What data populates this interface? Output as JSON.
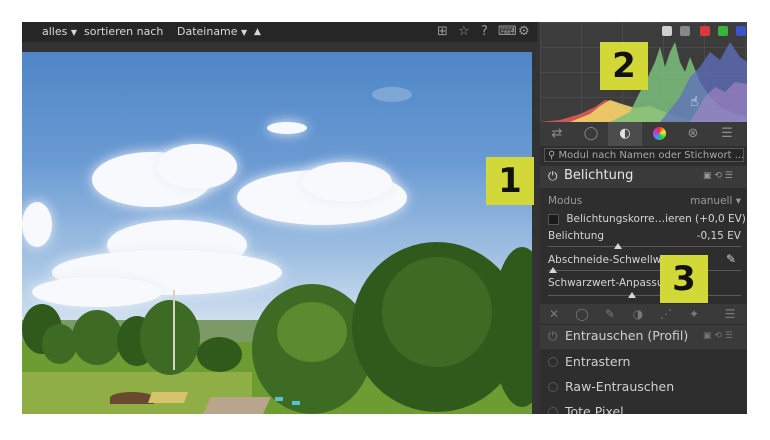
{
  "toolbar": {
    "filter": "alles",
    "sort_label": "sortieren nach",
    "sort_field": "Dateiname",
    "sort_dir_icon": "triangle-up",
    "caret_icon": "triangle-down"
  },
  "histogram": {
    "mode_buttons": [
      "histogram-icon",
      "waveform-icon"
    ],
    "channel_colors": [
      "#d93a3a",
      "#39b539",
      "#3b55c9"
    ]
  },
  "panel": {
    "search_placeholder": "Modul nach Namen oder Stichwort ...",
    "module_title": "Belichtung",
    "mode_label": "Modus",
    "mode_value": "manuell",
    "exposure_correction": "Belichtungskorre…ieren (+0,0 EV)",
    "exposure_label": "Belichtung",
    "exposure_value": "-0,15 EV",
    "clip_label": "Abschneide-Schwellwert",
    "black_label": "Schwarzwert-Anpassung",
    "modules": [
      "Entrauschen (Profil)",
      "Entrastern",
      "Raw-Entrauschen",
      "Tote Pixel"
    ]
  },
  "callouts": [
    "1",
    "2",
    "3"
  ]
}
